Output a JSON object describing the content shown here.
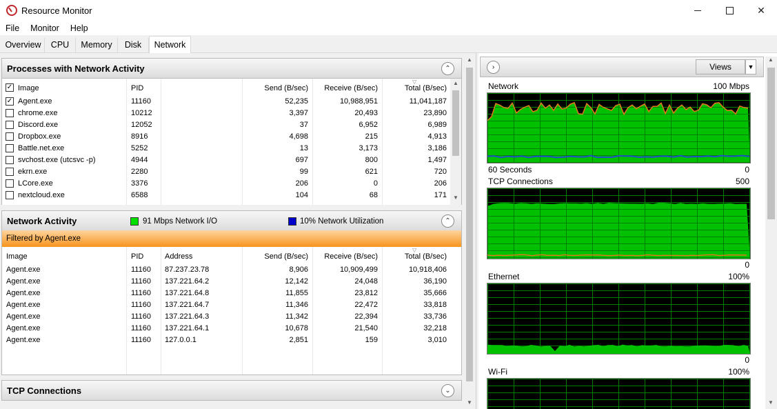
{
  "window": {
    "title": "Resource Monitor"
  },
  "menu": [
    "File",
    "Monitor",
    "Help"
  ],
  "tabs": [
    "Overview",
    "CPU",
    "Memory",
    "Disk",
    "Network"
  ],
  "processes": {
    "title": "Processes with Network Activity",
    "headers": {
      "image": "Image",
      "pid": "PID",
      "send": "Send (B/sec)",
      "receive": "Receive (B/sec)",
      "total": "Total (B/sec)"
    },
    "rows": [
      {
        "image": "Agent.exe",
        "pid": "11160",
        "send": "52,235",
        "receive": "10,988,951",
        "total": "11,041,187",
        "checked": true
      },
      {
        "image": "chrome.exe",
        "pid": "10212",
        "send": "3,397",
        "receive": "20,493",
        "total": "23,890",
        "checked": false
      },
      {
        "image": "Discord.exe",
        "pid": "12052",
        "send": "37",
        "receive": "6,952",
        "total": "6,989",
        "checked": false
      },
      {
        "image": "Dropbox.exe",
        "pid": "8916",
        "send": "4,698",
        "receive": "215",
        "total": "4,913",
        "checked": false
      },
      {
        "image": "Battle.net.exe",
        "pid": "5252",
        "send": "13",
        "receive": "3,173",
        "total": "3,186",
        "checked": false
      },
      {
        "image": "svchost.exe (utcsvc -p)",
        "pid": "4944",
        "send": "697",
        "receive": "800",
        "total": "1,497",
        "checked": false
      },
      {
        "image": "ekrn.exe",
        "pid": "2280",
        "send": "99",
        "receive": "621",
        "total": "720",
        "checked": false
      },
      {
        "image": "LCore.exe",
        "pid": "3376",
        "send": "206",
        "receive": "0",
        "total": "206",
        "checked": false
      },
      {
        "image": "nextcloud.exe",
        "pid": "6588",
        "send": "104",
        "receive": "68",
        "total": "171",
        "checked": false
      }
    ]
  },
  "network_activity": {
    "title": "Network Activity",
    "legend_io": "91 Mbps Network I/O",
    "legend_util": "10% Network Utilization",
    "filter": "Filtered by Agent.exe",
    "headers": {
      "image": "Image",
      "pid": "PID",
      "address": "Address",
      "send": "Send (B/sec)",
      "receive": "Receive (B/sec)",
      "total": "Total (B/sec)"
    },
    "rows": [
      {
        "image": "Agent.exe",
        "pid": "11160",
        "address": "87.237.23.78",
        "send": "8,906",
        "receive": "10,909,499",
        "total": "10,918,406"
      },
      {
        "image": "Agent.exe",
        "pid": "11160",
        "address": "137.221.64.2",
        "send": "12,142",
        "receive": "24,048",
        "total": "36,190"
      },
      {
        "image": "Agent.exe",
        "pid": "11160",
        "address": "137.221.64.8",
        "send": "11,855",
        "receive": "23,812",
        "total": "35,666"
      },
      {
        "image": "Agent.exe",
        "pid": "11160",
        "address": "137.221.64.7",
        "send": "11,346",
        "receive": "22,472",
        "total": "33,818"
      },
      {
        "image": "Agent.exe",
        "pid": "11160",
        "address": "137.221.64.3",
        "send": "11,342",
        "receive": "22,394",
        "total": "33,736"
      },
      {
        "image": "Agent.exe",
        "pid": "11160",
        "address": "137.221.64.1",
        "send": "10,678",
        "receive": "21,540",
        "total": "32,218"
      },
      {
        "image": "Agent.exe",
        "pid": "11160",
        "address": "127.0.0.1",
        "send": "2,851",
        "receive": "159",
        "total": "3,010"
      }
    ]
  },
  "tcp": {
    "title": "TCP Connections"
  },
  "right_panel": {
    "views_label": "Views",
    "graphs": [
      {
        "label": "Network",
        "max": "100 Mbps",
        "footer_left": "60 Seconds",
        "footer_right": "0"
      },
      {
        "label": "TCP Connections",
        "max": "500",
        "footer_right": "0"
      },
      {
        "label": "Ethernet",
        "max": "100%",
        "footer_right": "0"
      },
      {
        "label": "Wi-Fi",
        "max": "100%"
      }
    ]
  },
  "colors": {
    "graph_bg": "#000000",
    "graph_green": "#00c000",
    "grid": "#008000",
    "orange": "#e07a1a",
    "blue": "#1e50c8",
    "filter_orange": "#f7941d",
    "legend_io": "#00e000",
    "legend_util": "#0000c8"
  }
}
